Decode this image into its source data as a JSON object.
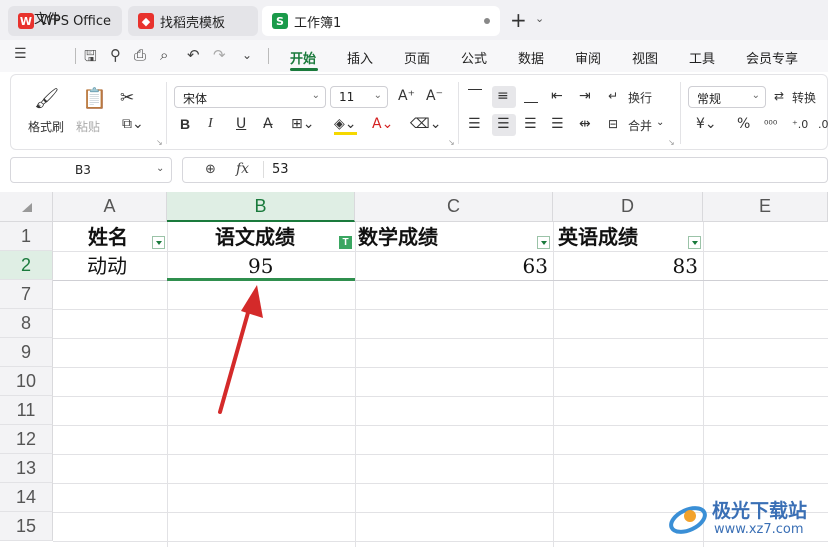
{
  "tabs": [
    {
      "label": "WPS Office"
    },
    {
      "label": "找稻壳模板"
    },
    {
      "label": "工作簿1"
    }
  ],
  "menubar": {
    "file": "文件",
    "items": [
      "开始",
      "插入",
      "页面",
      "公式",
      "数据",
      "审阅",
      "视图",
      "工具",
      "会员专享"
    ]
  },
  "ribbon": {
    "format_painter": "格式刷",
    "paste": "粘贴",
    "font_name": "宋体",
    "font_size": "11",
    "wrap_text": "换行",
    "merge": "合并",
    "number_format": "常规",
    "convert": "转换",
    "currency_symbol": "¥",
    "percent_symbol": "%"
  },
  "formula_bar": {
    "name_box": "B3",
    "fx": "fx",
    "value": "53"
  },
  "columns": [
    "A",
    "B",
    "C",
    "D",
    "E"
  ],
  "rows": [
    "1",
    "2",
    "7",
    "8",
    "9",
    "10",
    "11",
    "12",
    "13",
    "14",
    "15"
  ],
  "cells": {
    "A1": "姓名",
    "B1": "语文成绩",
    "C1": "数学成绩",
    "D1": "英语成绩",
    "A2": "动动",
    "B2": "95",
    "C2": "63",
    "D2": "83"
  },
  "filter_active_marker": "T",
  "watermark": {
    "name": "极光下载站",
    "url": "www.xz7.com"
  },
  "colors": {
    "accent": "#1a7a3c",
    "arrow": "#d42a2a"
  }
}
